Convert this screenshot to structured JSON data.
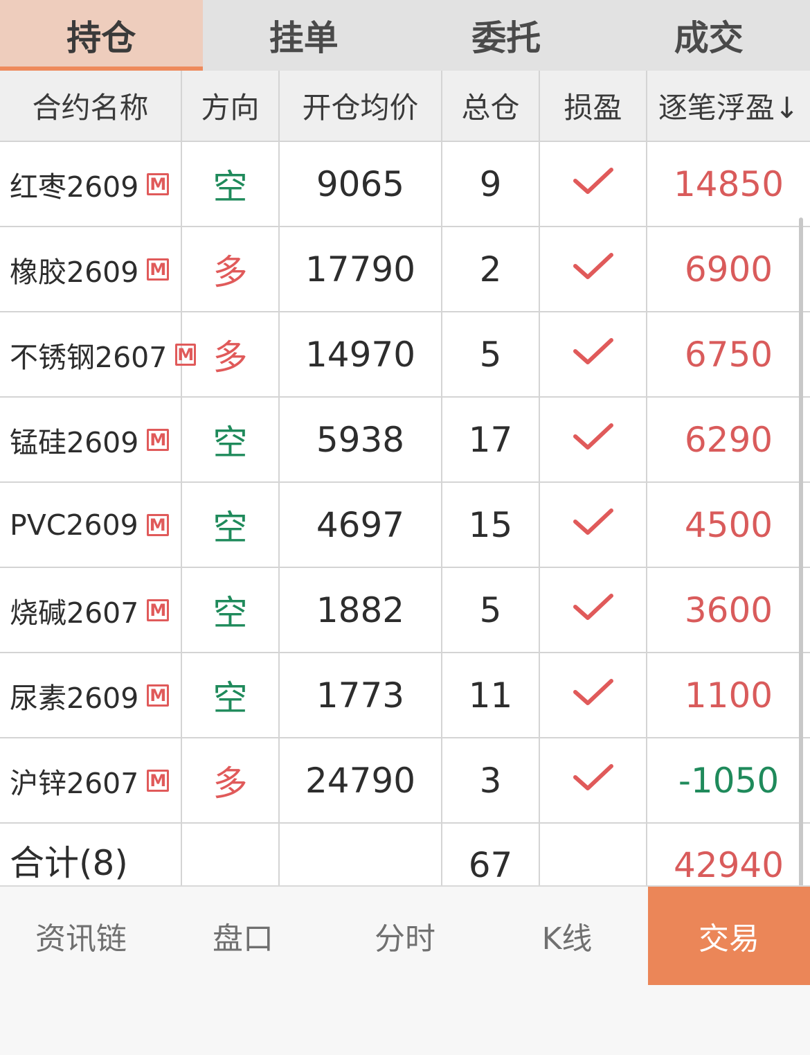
{
  "tabs": [
    {
      "label": "持仓",
      "active": true
    },
    {
      "label": "挂单",
      "active": false
    },
    {
      "label": "委托",
      "active": false
    },
    {
      "label": "成交",
      "active": false
    }
  ],
  "table": {
    "headers": [
      "合约名称",
      "方向",
      "开仓均价",
      "总仓",
      "损盈",
      "逐笔浮盈↓"
    ],
    "badge": "M",
    "rows": [
      {
        "name": "红枣2609",
        "direction": "空",
        "avg_price": "9065",
        "total": "9",
        "pnl": "14850"
      },
      {
        "name": "橡胶2609",
        "direction": "多",
        "avg_price": "17790",
        "total": "2",
        "pnl": "6900"
      },
      {
        "name": "不锈钢2607",
        "direction": "多",
        "avg_price": "14970",
        "total": "5",
        "pnl": "6750"
      },
      {
        "name": "锰硅2609",
        "direction": "空",
        "avg_price": "5938",
        "total": "17",
        "pnl": "6290"
      },
      {
        "name": "PVC2609",
        "direction": "空",
        "avg_price": "4697",
        "total": "15",
        "pnl": "4500"
      },
      {
        "name": "烧碱2607",
        "direction": "空",
        "avg_price": "1882",
        "total": "5",
        "pnl": "3600"
      },
      {
        "name": "尿素2609",
        "direction": "空",
        "avg_price": "1773",
        "total": "11",
        "pnl": "1100"
      },
      {
        "name": "沪锌2607",
        "direction": "多",
        "avg_price": "24790",
        "total": "3",
        "pnl": "-1050"
      }
    ],
    "total": {
      "label": "合计(8)",
      "total": "67",
      "pnl": "42940"
    }
  },
  "colors": {
    "accent": "#eb8658",
    "long": "#e05a5a",
    "short": "#1f8a5b",
    "profit": "#d95b5b",
    "loss": "#1f8a5b"
  },
  "bottom_nav": [
    {
      "label": "资讯链",
      "active": false
    },
    {
      "label": "盘口",
      "active": false
    },
    {
      "label": "分时",
      "active": false
    },
    {
      "label": "K线",
      "active": false
    },
    {
      "label": "交易",
      "active": true
    }
  ]
}
